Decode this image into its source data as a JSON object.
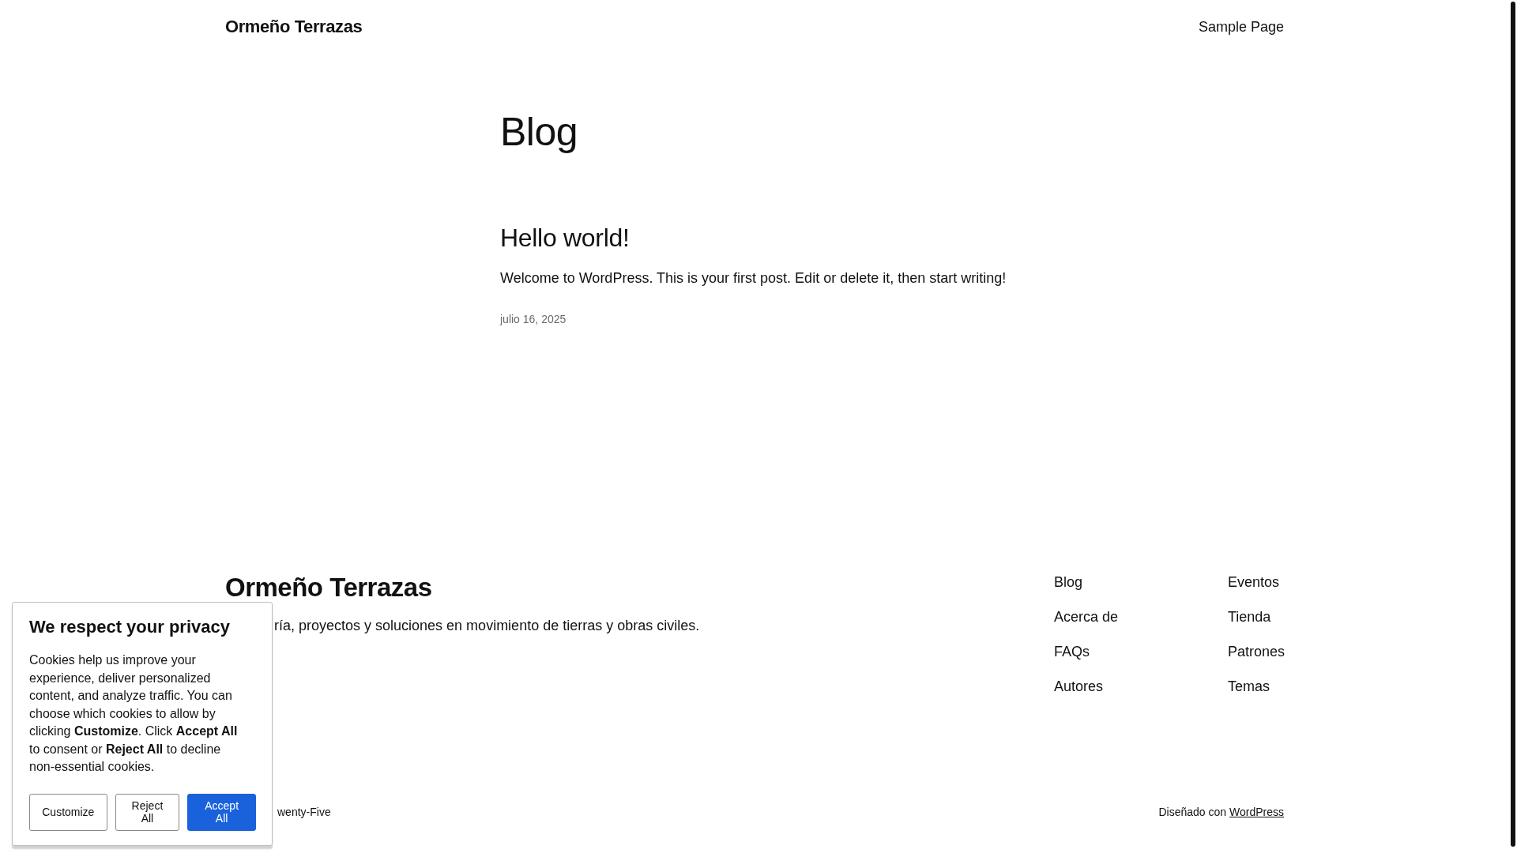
{
  "header": {
    "site_title": "Ormeño Terrazas",
    "nav": [
      "Sample Page"
    ]
  },
  "page_title": "Blog",
  "posts": [
    {
      "title": "Hello world!",
      "excerpt": "Welcome to WordPress. This is your first post. Edit or delete it, then start writing!",
      "date": "julio 16, 2025"
    }
  ],
  "footer": {
    "site_title": "Ormeño Terrazas",
    "tagline": "ría, proyectos y soluciones en movimiento de tierras y obras civiles.",
    "nav_columns": [
      [
        "Blog",
        "Acerca de",
        "FAQs",
        "Autores"
      ],
      [
        "Eventos",
        "Tienda",
        "Patrones",
        "Temas"
      ]
    ],
    "theme_credit": "wenty-Five",
    "credit_prefix": "Diseñado con",
    "credit_link": "WordPress"
  },
  "cookie_banner": {
    "title": "We respect your privacy",
    "text": "Cookies help us improve your experience, deliver personalized content, and analyze traffic. You can choose which cookies to allow by clicking **Customize**. Click **Accept All** to consent or **Reject All** to decline non-essential cookies.",
    "buttons": [
      {
        "label": "Customize",
        "kind": "outline"
      },
      {
        "label": "Reject All",
        "kind": "outline"
      },
      {
        "label": "Accept All",
        "kind": "primary"
      }
    ]
  }
}
